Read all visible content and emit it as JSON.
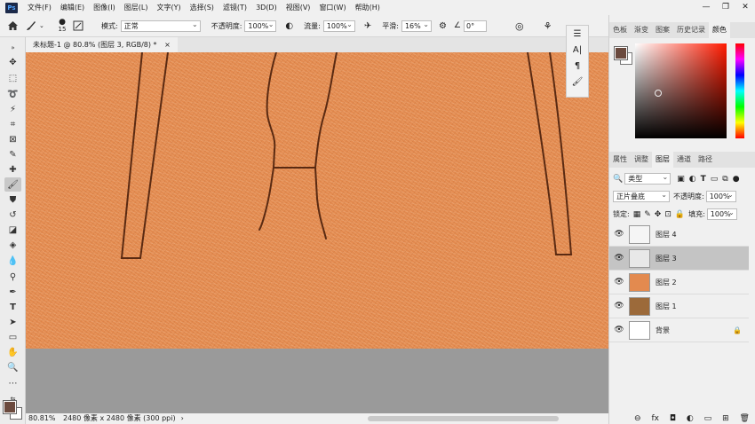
{
  "menubar": {
    "logo": "Ps",
    "items": [
      "文件(F)",
      "编辑(E)",
      "图像(I)",
      "图层(L)",
      "文字(Y)",
      "选择(S)",
      "滤镜(T)",
      "3D(D)",
      "视图(V)",
      "窗口(W)",
      "帮助(H)"
    ],
    "window_controls": [
      "—",
      "❐",
      "✕"
    ]
  },
  "options": {
    "brush_size": "15",
    "mode_label": "模式:",
    "mode_value": "正常",
    "opacity_label": "不透明度:",
    "opacity_value": "100%",
    "flow_label": "流量:",
    "flow_value": "100%",
    "smooth_label": "平滑:",
    "smooth_value": "16%",
    "angle_value": "0°"
  },
  "document": {
    "tab_title": "未标题-1 @ 80.8% (图层 3, RGB/8) *",
    "close": "×"
  },
  "status": {
    "zoom": "80.81%",
    "info": "2480 像素 x 2480 像素 (300 ppi)",
    "arrow": "›"
  },
  "color_panel": {
    "tabs": [
      "色板",
      "渐变",
      "图案",
      "历史记录",
      "颜色"
    ],
    "active_tab": "颜色",
    "foreground": "#6b4a3e",
    "background": "#ffffff",
    "hue_base": "#ff1a00"
  },
  "layers_panel": {
    "tabs": [
      "属性",
      "调整",
      "图层",
      "通道",
      "路径"
    ],
    "active_tab": "图层",
    "filter_label": "类型",
    "blend_mode": "正片叠底",
    "opacity_label": "不透明度:",
    "opacity_value": "100%",
    "lock_label": "锁定:",
    "fill_label": "填充:",
    "fill_value": "100%",
    "layers": [
      {
        "name": "图层 4",
        "thumb": "#f5f5f5",
        "selected": false
      },
      {
        "name": "图层 3",
        "thumb": "#e8e8e8",
        "selected": true
      },
      {
        "name": "图层 2",
        "thumb": "#e38a4f",
        "selected": false
      },
      {
        "name": "图层 1",
        "thumb": "#9c6a3a",
        "selected": false
      },
      {
        "name": "背景",
        "thumb": "#ffffff",
        "selected": false
      }
    ],
    "footer_icons": [
      "⊖",
      "fx",
      "◘",
      "◐",
      "▭",
      "⊞",
      "🗑"
    ]
  }
}
